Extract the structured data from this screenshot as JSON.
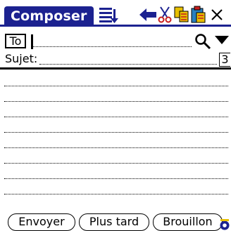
{
  "title": "Composer",
  "toolbar": {
    "icons": [
      "details-icon",
      "back-arrow-icon",
      "cut-icon",
      "copy-icon",
      "paste-icon",
      "close-icon"
    ]
  },
  "to": {
    "label": "To",
    "value": ""
  },
  "subject": {
    "label": "Sujet:",
    "value": "",
    "count": "3"
  },
  "body_text": "",
  "buttons": {
    "send": "Envoyer",
    "later": "Plus tard",
    "draft": "Brouillon"
  },
  "colors": {
    "accent": "#1c2290",
    "icon_red": "#c81e1e",
    "icon_yellow": "#e8c000",
    "icon_blue": "#1c2290"
  }
}
